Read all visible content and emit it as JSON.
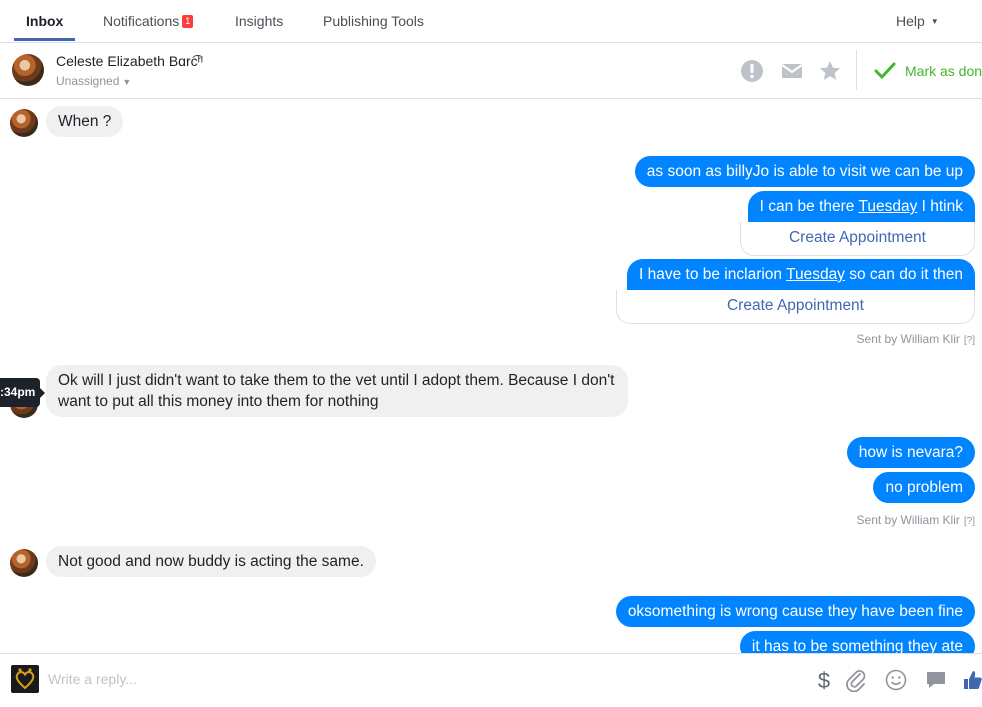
{
  "nav": {
    "tabs": [
      {
        "label": "Inbox"
      },
      {
        "label": "Notifications"
      },
      {
        "label": "Insights"
      },
      {
        "label": "Publishing Tools"
      }
    ],
    "notifications_badge": "1",
    "help_label": "Help"
  },
  "conversation": {
    "contact_name": "Celeste Elizabeth Bɑrc͡ʰ",
    "assignee": "Unassigned",
    "mark_done_label": "Mark as don"
  },
  "messages": {
    "m1": "When ?",
    "m2": "as soon as billyJo is able to visit we can be up",
    "m3_pre": "I can be there ",
    "m3_link": "Tuesday",
    "m3_post": " I htink",
    "appt1": "Create Appointment",
    "m4_pre": "I have to be inclarion ",
    "m4_link": "Tuesday",
    "m4_post": " so can do it then",
    "appt2": "Create Appointment",
    "sent1_by": "Sent by William Klir",
    "sent1_q": "[?]",
    "tooltip_time": ":34pm",
    "m5": "Ok will I just didn't want to take them to the vet until I adopt them. Because I don't want to put all this money into them for nothing",
    "m6": "how is nevara?",
    "m7": "no problem",
    "sent2_by": "Sent by William Klir",
    "sent2_q": "[?]",
    "m8": "Not good and now buddy is acting the same.",
    "m9": "oksomething is wrong cause they have been fine",
    "m10": "it has to be something they ate"
  },
  "composer": {
    "placeholder": "Write a reply..."
  },
  "colors": {
    "accent_blue": "#0084ff",
    "nav_underline": "#4267b2",
    "done_green": "#42b72a",
    "badge_red": "#fa3e3e"
  },
  "icons": [
    "alert-icon",
    "envelope-icon",
    "star-icon",
    "checkmark-icon",
    "dollar-icon",
    "paperclip-icon",
    "smiley-icon",
    "sticker-icon",
    "thumbs-up-icon"
  ]
}
